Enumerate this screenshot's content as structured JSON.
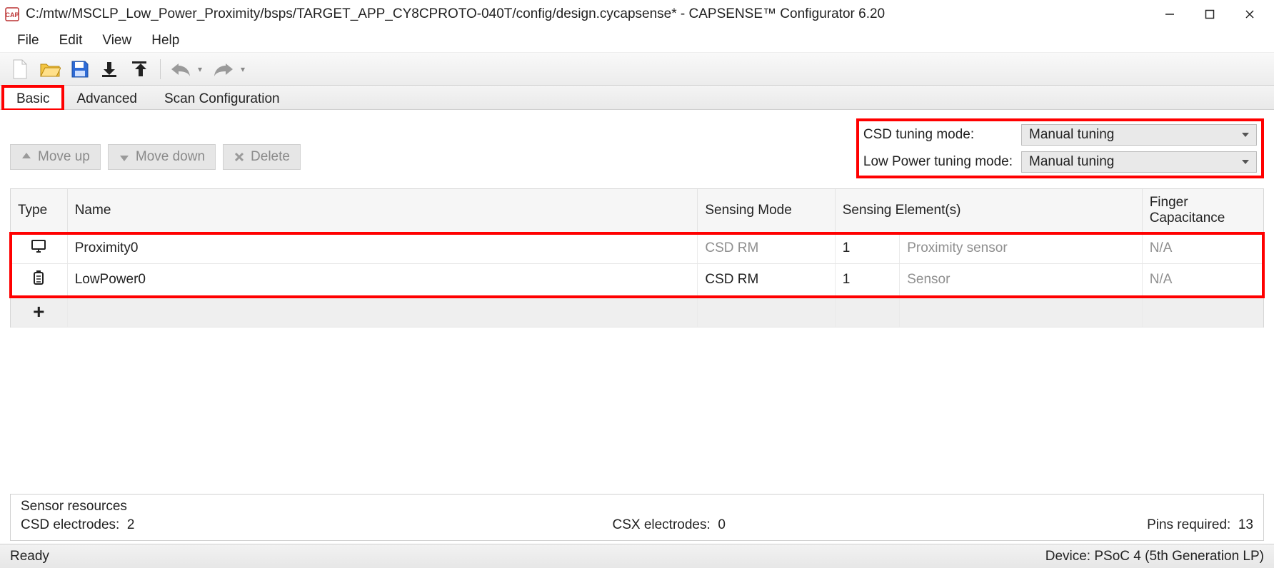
{
  "window": {
    "title": "C:/mtw/MSCLP_Low_Power_Proximity/bsps/TARGET_APP_CY8CPROTO-040T/config/design.cycapsense* - CAPSENSE™ Configurator 6.20"
  },
  "menu": {
    "file": "File",
    "edit": "Edit",
    "view": "View",
    "help": "Help"
  },
  "tabs": {
    "basic": "Basic",
    "advanced": "Advanced",
    "scan": "Scan Configuration"
  },
  "actions": {
    "moveup": "Move up",
    "movedown": "Move down",
    "delete": "Delete"
  },
  "tuning": {
    "csd_label": "CSD tuning mode:",
    "csd_value": "Manual tuning",
    "lp_label": "Low Power tuning mode:",
    "lp_value": "Manual tuning"
  },
  "table": {
    "headers": {
      "type": "Type",
      "name": "Name",
      "sensing_mode": "Sensing Mode",
      "sensing_elements": "Sensing Element(s)",
      "finger_cap": "Finger Capacitance"
    },
    "rows": [
      {
        "icon": "monitor",
        "name": "Proximity0",
        "mode": "CSD RM",
        "mode_dim": true,
        "count": "1",
        "elem": "Proximity sensor",
        "fc": "N/A"
      },
      {
        "icon": "battery",
        "name": "LowPower0",
        "mode": "CSD RM",
        "mode_dim": false,
        "count": "1",
        "elem": "Sensor",
        "fc": "N/A"
      }
    ]
  },
  "resources": {
    "title": "Sensor resources",
    "csd_label": "CSD electrodes:",
    "csd_value": "2",
    "csx_label": "CSX electrodes:",
    "csx_value": "0",
    "pins_label": "Pins required:",
    "pins_value": "13"
  },
  "status": {
    "ready": "Ready",
    "device": "Device: PSoC 4 (5th Generation LP)"
  }
}
